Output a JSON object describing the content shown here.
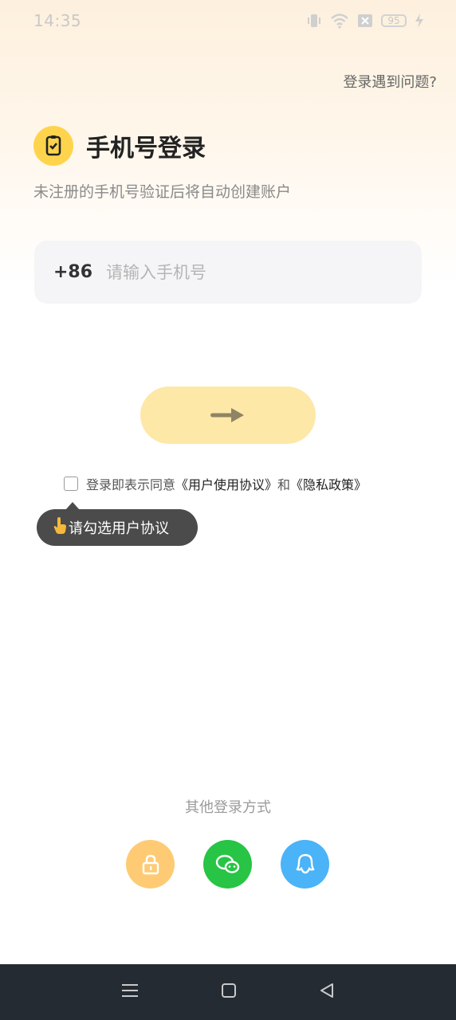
{
  "status_bar": {
    "time": "14:35",
    "battery_level": "95",
    "icons": [
      "vibrate-icon",
      "wifi-icon",
      "sim-off-icon",
      "battery-icon",
      "charging-icon"
    ]
  },
  "header": {
    "help_link": "登录遇到问题?"
  },
  "login": {
    "title": "手机号登录",
    "subtitle": "未注册的手机号验证后将自动创建账户",
    "country_code": "+86",
    "phone_placeholder": "请输入手机号",
    "submit_icon": "arrow-right-icon"
  },
  "agreement": {
    "prefix": "登录即表示同意",
    "user_agreement": "《用户使用协议》",
    "and": "和",
    "privacy_policy": "《隐私政策》",
    "checked": false,
    "tooltip": "请勾选用户协议"
  },
  "other_login": {
    "title": "其他登录方式",
    "methods": [
      {
        "name": "lock-icon",
        "color": "#fecb74"
      },
      {
        "name": "wechat-icon",
        "color": "#28c445"
      },
      {
        "name": "qq-icon",
        "color": "#4bb3f7"
      }
    ]
  },
  "colors": {
    "accent": "#ffd44d",
    "button_disabled": "#fde8a8",
    "nav_bar": "#252b33"
  }
}
